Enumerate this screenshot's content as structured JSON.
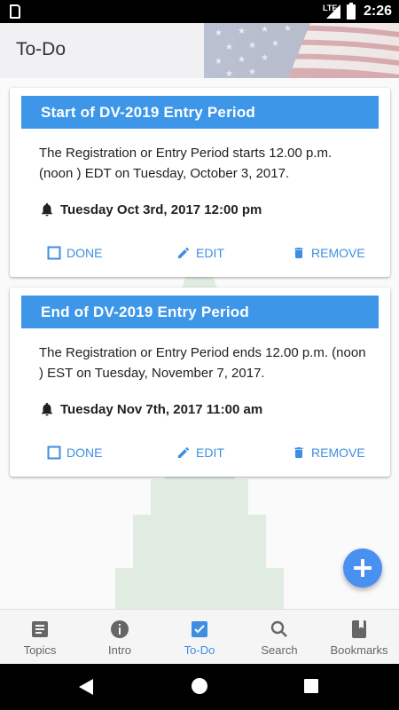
{
  "status_bar": {
    "network": "LTE",
    "time": "2:26"
  },
  "header": {
    "title": "To-Do"
  },
  "todos": [
    {
      "title": "Start of DV-2019 Entry Period",
      "description": "The Registration or Entry Period starts 12.00 p.m. (noon ) EDT on Tuesday, October 3, 2017.",
      "reminder": "Tuesday Oct 3rd, 2017 12:00 pm",
      "actions": {
        "done": "DONE",
        "edit": "EDIT",
        "remove": "REMOVE"
      }
    },
    {
      "title": "End of DV-2019 Entry Period",
      "description": "The Registration or Entry Period ends 12.00 p.m. (noon ) EST on Tuesday, November 7, 2017.",
      "reminder": "Tuesday Nov 7th, 2017 11:00 am",
      "actions": {
        "done": "DONE",
        "edit": "EDIT",
        "remove": "REMOVE"
      }
    }
  ],
  "bottom_nav": {
    "items": [
      {
        "label": "Topics",
        "icon": "article-icon"
      },
      {
        "label": "Intro",
        "icon": "info-icon"
      },
      {
        "label": "To-Do",
        "icon": "checkbox-icon",
        "active": true
      },
      {
        "label": "Search",
        "icon": "search-icon"
      },
      {
        "label": "Bookmarks",
        "icon": "book-icon"
      }
    ]
  },
  "colors": {
    "accent": "#3d96e8",
    "action": "#3d8ee0",
    "fab": "#4a90f0"
  }
}
